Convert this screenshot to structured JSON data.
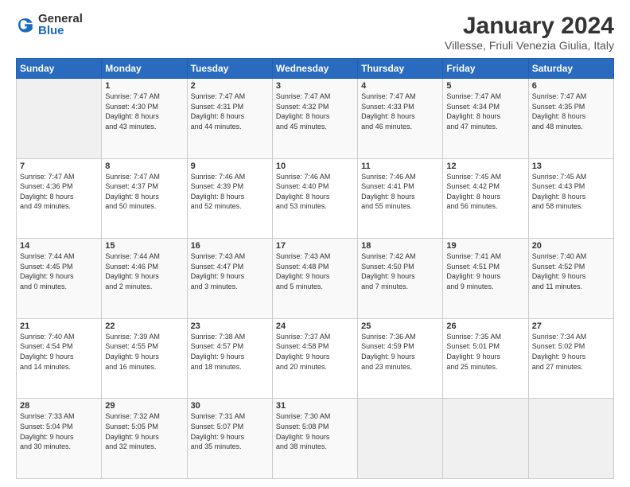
{
  "logo": {
    "general": "General",
    "blue": "Blue"
  },
  "title": "January 2024",
  "subtitle": "Villesse, Friuli Venezia Giulia, Italy",
  "days_header": [
    "Sunday",
    "Monday",
    "Tuesday",
    "Wednesday",
    "Thursday",
    "Friday",
    "Saturday"
  ],
  "weeks": [
    [
      {
        "day": "",
        "info": ""
      },
      {
        "day": "1",
        "info": "Sunrise: 7:47 AM\nSunset: 4:30 PM\nDaylight: 8 hours\nand 43 minutes."
      },
      {
        "day": "2",
        "info": "Sunrise: 7:47 AM\nSunset: 4:31 PM\nDaylight: 8 hours\nand 44 minutes."
      },
      {
        "day": "3",
        "info": "Sunrise: 7:47 AM\nSunset: 4:32 PM\nDaylight: 8 hours\nand 45 minutes."
      },
      {
        "day": "4",
        "info": "Sunrise: 7:47 AM\nSunset: 4:33 PM\nDaylight: 8 hours\nand 46 minutes."
      },
      {
        "day": "5",
        "info": "Sunrise: 7:47 AM\nSunset: 4:34 PM\nDaylight: 8 hours\nand 47 minutes."
      },
      {
        "day": "6",
        "info": "Sunrise: 7:47 AM\nSunset: 4:35 PM\nDaylight: 8 hours\nand 48 minutes."
      }
    ],
    [
      {
        "day": "7",
        "info": "Sunrise: 7:47 AM\nSunset: 4:36 PM\nDaylight: 8 hours\nand 49 minutes."
      },
      {
        "day": "8",
        "info": "Sunrise: 7:47 AM\nSunset: 4:37 PM\nDaylight: 8 hours\nand 50 minutes."
      },
      {
        "day": "9",
        "info": "Sunrise: 7:46 AM\nSunset: 4:39 PM\nDaylight: 8 hours\nand 52 minutes."
      },
      {
        "day": "10",
        "info": "Sunrise: 7:46 AM\nSunset: 4:40 PM\nDaylight: 8 hours\nand 53 minutes."
      },
      {
        "day": "11",
        "info": "Sunrise: 7:46 AM\nSunset: 4:41 PM\nDaylight: 8 hours\nand 55 minutes."
      },
      {
        "day": "12",
        "info": "Sunrise: 7:45 AM\nSunset: 4:42 PM\nDaylight: 8 hours\nand 56 minutes."
      },
      {
        "day": "13",
        "info": "Sunrise: 7:45 AM\nSunset: 4:43 PM\nDaylight: 8 hours\nand 58 minutes."
      }
    ],
    [
      {
        "day": "14",
        "info": "Sunrise: 7:44 AM\nSunset: 4:45 PM\nDaylight: 9 hours\nand 0 minutes."
      },
      {
        "day": "15",
        "info": "Sunrise: 7:44 AM\nSunset: 4:46 PM\nDaylight: 9 hours\nand 2 minutes."
      },
      {
        "day": "16",
        "info": "Sunrise: 7:43 AM\nSunset: 4:47 PM\nDaylight: 9 hours\nand 3 minutes."
      },
      {
        "day": "17",
        "info": "Sunrise: 7:43 AM\nSunset: 4:48 PM\nDaylight: 9 hours\nand 5 minutes."
      },
      {
        "day": "18",
        "info": "Sunrise: 7:42 AM\nSunset: 4:50 PM\nDaylight: 9 hours\nand 7 minutes."
      },
      {
        "day": "19",
        "info": "Sunrise: 7:41 AM\nSunset: 4:51 PM\nDaylight: 9 hours\nand 9 minutes."
      },
      {
        "day": "20",
        "info": "Sunrise: 7:40 AM\nSunset: 4:52 PM\nDaylight: 9 hours\nand 11 minutes."
      }
    ],
    [
      {
        "day": "21",
        "info": "Sunrise: 7:40 AM\nSunset: 4:54 PM\nDaylight: 9 hours\nand 14 minutes."
      },
      {
        "day": "22",
        "info": "Sunrise: 7:39 AM\nSunset: 4:55 PM\nDaylight: 9 hours\nand 16 minutes."
      },
      {
        "day": "23",
        "info": "Sunrise: 7:38 AM\nSunset: 4:57 PM\nDaylight: 9 hours\nand 18 minutes."
      },
      {
        "day": "24",
        "info": "Sunrise: 7:37 AM\nSunset: 4:58 PM\nDaylight: 9 hours\nand 20 minutes."
      },
      {
        "day": "25",
        "info": "Sunrise: 7:36 AM\nSunset: 4:59 PM\nDaylight: 9 hours\nand 23 minutes."
      },
      {
        "day": "26",
        "info": "Sunrise: 7:35 AM\nSunset: 5:01 PM\nDaylight: 9 hours\nand 25 minutes."
      },
      {
        "day": "27",
        "info": "Sunrise: 7:34 AM\nSunset: 5:02 PM\nDaylight: 9 hours\nand 27 minutes."
      }
    ],
    [
      {
        "day": "28",
        "info": "Sunrise: 7:33 AM\nSunset: 5:04 PM\nDaylight: 9 hours\nand 30 minutes."
      },
      {
        "day": "29",
        "info": "Sunrise: 7:32 AM\nSunset: 5:05 PM\nDaylight: 9 hours\nand 32 minutes."
      },
      {
        "day": "30",
        "info": "Sunrise: 7:31 AM\nSunset: 5:07 PM\nDaylight: 9 hours\nand 35 minutes."
      },
      {
        "day": "31",
        "info": "Sunrise: 7:30 AM\nSunset: 5:08 PM\nDaylight: 9 hours\nand 38 minutes."
      },
      {
        "day": "",
        "info": ""
      },
      {
        "day": "",
        "info": ""
      },
      {
        "day": "",
        "info": ""
      }
    ]
  ]
}
